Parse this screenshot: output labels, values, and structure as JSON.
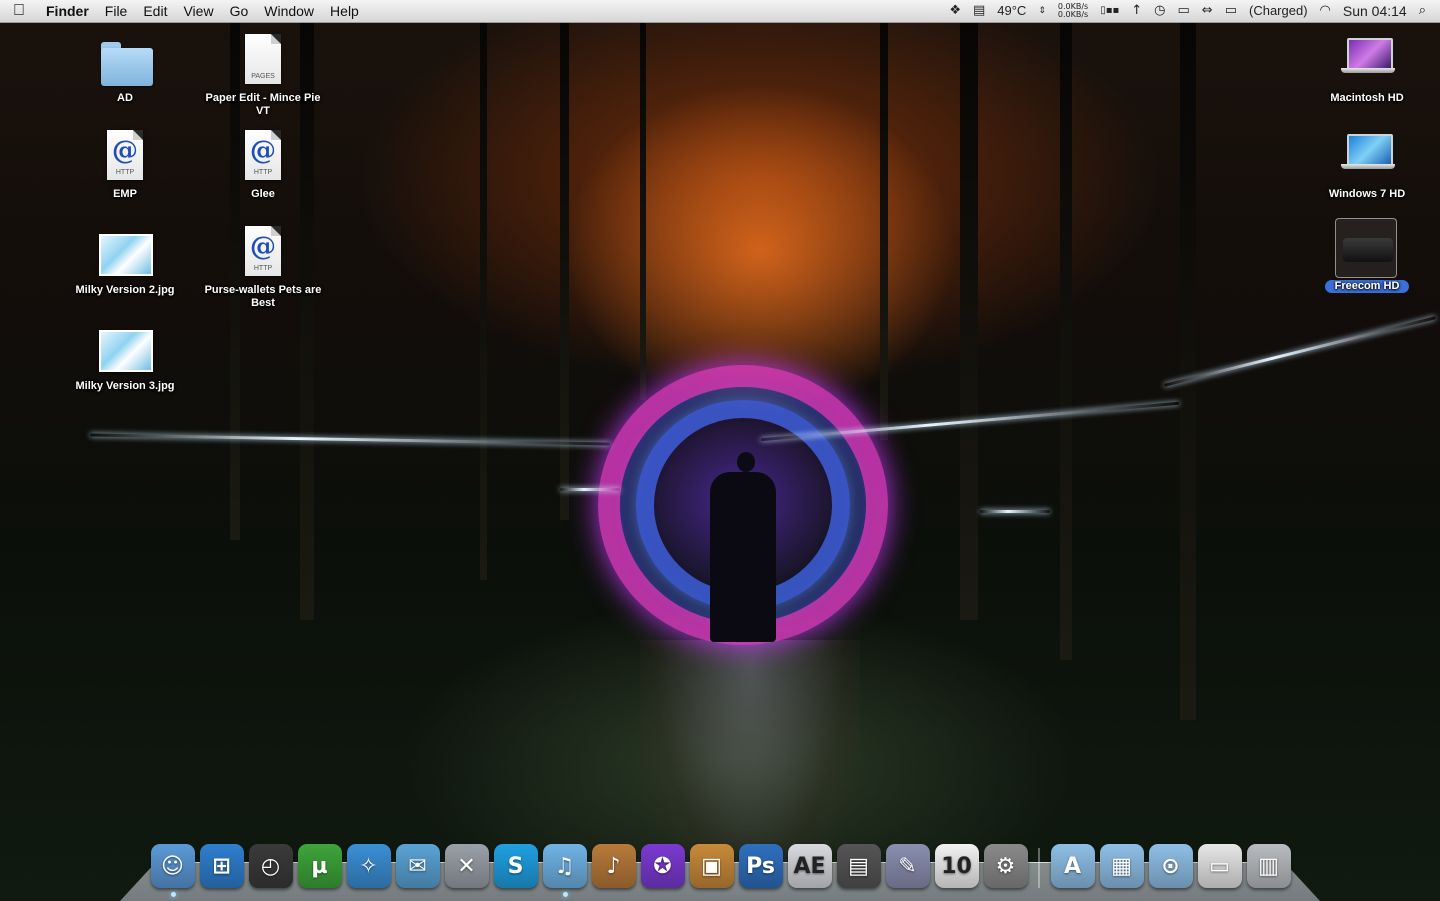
{
  "menubar": {
    "app_name": "Finder",
    "menus": [
      "File",
      "Edit",
      "View",
      "Go",
      "Window",
      "Help"
    ],
    "status": {
      "temperature": "49°C",
      "net_up": "0.0KB/s",
      "net_down": "0.0KB/s",
      "battery": "(Charged)",
      "clock": "Sun 04:14"
    }
  },
  "desktop": {
    "left_icons": [
      {
        "label": "AD",
        "kind": "folder"
      },
      {
        "label": "Paper Edit - Mince Pie VT",
        "kind": "pages-doc",
        "tag": "PAGES"
      },
      {
        "label": "EMP",
        "kind": "http-doc",
        "tag": "HTTP"
      },
      {
        "label": "Glee",
        "kind": "http-doc",
        "tag": "HTTP"
      },
      {
        "label": "Milky Version 2.jpg",
        "kind": "image"
      },
      {
        "label": "Purse-wallets Pets are Best",
        "kind": "http-doc",
        "tag": "HTTP"
      },
      {
        "label": "Milky Version 3.jpg",
        "kind": "image"
      }
    ],
    "right_icons": [
      {
        "label": "Macintosh HD",
        "kind": "laptop"
      },
      {
        "label": "Windows 7 HD",
        "kind": "laptop"
      },
      {
        "label": "Freecom HD",
        "kind": "drive",
        "selected": true
      }
    ]
  },
  "dock": {
    "apps": [
      {
        "name": "finder-icon",
        "glyph": "☺",
        "color": "#5b9ad8",
        "running": true
      },
      {
        "name": "windows-icon",
        "glyph": "⊞",
        "color": "#2f7fd0",
        "running": false
      },
      {
        "name": "dashboard-icon",
        "glyph": "◴",
        "color": "#3a3a3a",
        "running": false
      },
      {
        "name": "utorrent-icon",
        "glyph": "µ",
        "color": "#3ea53a",
        "running": false
      },
      {
        "name": "safari-icon",
        "glyph": "✧",
        "color": "#3b8fd6",
        "running": false
      },
      {
        "name": "mail-stamp-icon",
        "glyph": "✉",
        "color": "#5aa3d6",
        "running": false
      },
      {
        "name": "x-chat-icon",
        "glyph": "✕",
        "color": "#9aa0a8",
        "running": false
      },
      {
        "name": "skype-icon",
        "glyph": "S",
        "color": "#1fa0e2",
        "running": false
      },
      {
        "name": "itunes-icon",
        "glyph": "♫",
        "color": "#6fb4e6",
        "running": true
      },
      {
        "name": "garageband-icon",
        "glyph": "♪",
        "color": "#b87a3a",
        "running": false
      },
      {
        "name": "imagewell-icon",
        "glyph": "✪",
        "color": "#7b3ad2",
        "running": false
      },
      {
        "name": "iphoto-icon",
        "glyph": "▣",
        "color": "#c88a3a",
        "running": false
      },
      {
        "name": "photoshop-icon",
        "glyph": "Ps",
        "color": "#2f6fbf",
        "running": false
      },
      {
        "name": "after-effects-icon",
        "glyph": "AE",
        "color": "#d8dadf",
        "running": false
      },
      {
        "name": "final-cut-icon",
        "glyph": "▤",
        "color": "#555",
        "running": false
      },
      {
        "name": "script-editor-icon",
        "glyph": "✎",
        "color": "#8a8fb0",
        "running": false
      },
      {
        "name": "ical-icon",
        "glyph": "10",
        "color": "#f2f2f2",
        "running": false
      },
      {
        "name": "system-preferences-icon",
        "glyph": "⚙",
        "color": "#8a8a8a",
        "running": false
      }
    ],
    "stacks": [
      {
        "name": "applications-stack-icon",
        "glyph": "A",
        "color": "#8fbfe6"
      },
      {
        "name": "documents-stack-icon",
        "glyph": "▦",
        "color": "#8fbfe6"
      },
      {
        "name": "downloads-stack-icon",
        "glyph": "⊙",
        "color": "#8fbfe6"
      },
      {
        "name": "window-stack-icon",
        "glyph": "▭",
        "color": "#e6e6e6"
      },
      {
        "name": "trash-icon",
        "glyph": "▥",
        "color": "#b9bcc0"
      }
    ]
  }
}
